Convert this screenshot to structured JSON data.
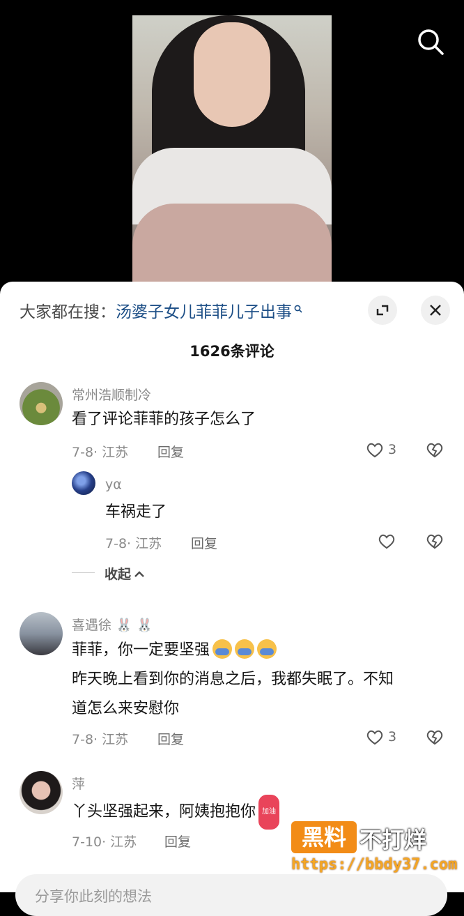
{
  "video": {
    "search_icon": "search-icon"
  },
  "panel": {
    "search_prefix": "大家都在搜：",
    "search_term": "汤婆子女儿菲菲儿子出事",
    "expand_icon": "expand-icon",
    "close_icon": "close-icon",
    "count_label": "1626条评论"
  },
  "comments": [
    {
      "user": "常州浩顺制冷",
      "lines": [
        "看了评论菲菲的孩子怎么了"
      ],
      "date": "7-8",
      "location": "江苏",
      "reply_label": "回复",
      "likes": "3"
    },
    {
      "user": "yα",
      "lines": [
        "车祸走了"
      ],
      "date": "7-8",
      "location": "江苏",
      "reply_label": "回复",
      "likes": ""
    },
    {
      "user": "喜遇徐",
      "user_suffix": "🐰 🐰",
      "lines": [
        "菲菲，你一定要坚强",
        "昨天晚上看到你的消息之后，我都失眠了。不知",
        "道怎么来安慰你"
      ],
      "date": "7-8",
      "location": "江苏",
      "reply_label": "回复",
      "likes": "3"
    },
    {
      "user": "萍",
      "lines": [
        "丫头坚强起来，阿姨抱抱你"
      ],
      "date": "7-10",
      "location": "江苏",
      "reply_label": "回复",
      "likes": "",
      "badge": "加油"
    }
  ],
  "collapse_label": "收起",
  "input_placeholder": "分享你此刻的想法",
  "watermark": {
    "label": "黑料",
    "text": "不打烊",
    "url": "https://bbdy37.com"
  },
  "colors": {
    "link": "#1c4e86",
    "orange": "#f28c17",
    "meta": "#8a8a8a"
  }
}
